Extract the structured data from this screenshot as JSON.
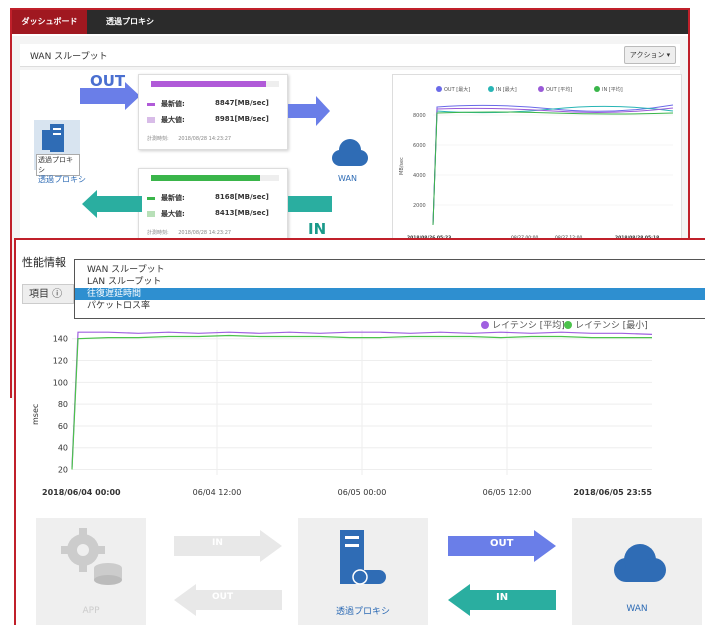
{
  "top_right_text": "",
  "tabs": [
    {
      "label": "ダッシュボード"
    },
    {
      "label": "透過プロキシ"
    }
  ],
  "wan": {
    "title": "WAN スループット",
    "action_label": "アクション ▾",
    "out_label": "OUT",
    "in_label": "IN",
    "proxy_badge": "透過プロキシ",
    "proxy_label": "透過プロキシ",
    "wan_label": "WAN",
    "out_card": {
      "latest_label": "最新値:",
      "latest_value": "8847[MB/sec]",
      "max_label": "最大値:",
      "max_value": "8981[MB/sec]",
      "time_label": "計測時刻:",
      "time_value": "2018/08/28 14:23:27",
      "fill": 0.9
    },
    "in_card": {
      "latest_label": "最新値:",
      "latest_value": "8168[MB/sec]",
      "max_label": "最大値:",
      "max_value": "8413[MB/sec]",
      "time_label": "計測時刻:",
      "time_value": "2018/08/28 14:23:27",
      "fill": 0.85
    },
    "colors": {
      "out_max": "#6a6ae8",
      "in_max": "#29b5b5",
      "out_avg": "#9a5ad8",
      "in_avg": "#3ab54a"
    }
  },
  "wan_chart": {
    "type": "line",
    "legend": [
      "OUT [最大]",
      "IN [最大]",
      "OUT [平均]",
      "IN [平均]"
    ],
    "ylabel": "MB/sec",
    "yticks": [
      "8000",
      "6000",
      "4000",
      "2000"
    ],
    "xticks": [
      "2018/08/26 05:23",
      "08/27 00:00",
      "08/27 12:00",
      "2018/08/28 05:18"
    ]
  },
  "perf": {
    "title": "性能情報",
    "item_label": "項目 ⓘ",
    "dropdown": [
      "WAN スループット",
      "LAN スループット",
      "往復遅延時間",
      "パケットロス率"
    ],
    "selected_index": 2
  },
  "chart_data": {
    "type": "line",
    "legend": [
      "レイテンシ [平均]",
      "レイテンシ [最小]"
    ],
    "ylabel": "msec",
    "yticks": [
      "140",
      "120",
      "100",
      "80",
      "60",
      "40",
      "20"
    ],
    "xticks": [
      "2018/06/04 00:00",
      "06/04 12:00",
      "06/05 00:00",
      "06/05 12:00",
      "2018/06/05 23:55"
    ],
    "ylim": [
      15,
      148
    ],
    "series": [
      {
        "name": "レイテンシ [平均]",
        "color": "#a060e0",
        "values": [
          22,
          146,
          146,
          145,
          146,
          145,
          146,
          145,
          146,
          145,
          146,
          146,
          145,
          146,
          145,
          146,
          145,
          146,
          145,
          145,
          144
        ]
      },
      {
        "name": "レイテンシ [最小]",
        "color": "#4cc24c",
        "values": [
          20,
          140,
          141,
          141,
          142,
          142,
          143,
          142,
          142,
          142,
          141,
          141,
          142,
          142,
          142,
          141,
          142,
          142,
          141,
          141,
          141
        ]
      }
    ]
  },
  "flow": {
    "app_label": "APP",
    "in_label": "IN",
    "out_label": "OUT",
    "proxy_label": "透過プロキシ",
    "out2_label": "OUT",
    "in2_label": "IN",
    "wan_label": "WAN"
  }
}
